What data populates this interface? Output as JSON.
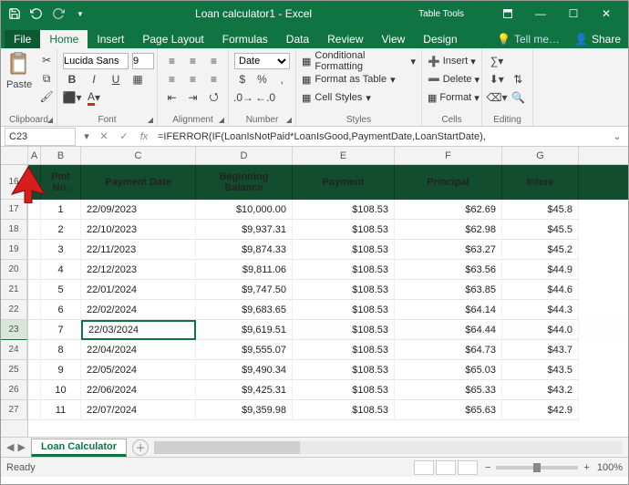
{
  "titlebar": {
    "title": "Loan calculator1 - Excel",
    "tool_context": "Table Tools"
  },
  "tabs": {
    "file": "File",
    "home": "Home",
    "insert": "Insert",
    "page_layout": "Page Layout",
    "formulas": "Formulas",
    "data": "Data",
    "review": "Review",
    "view": "View",
    "design": "Design",
    "tell_me": "Tell me…",
    "share": "Share"
  },
  "ribbon": {
    "paste": "Paste",
    "font_name": "Lucida Sans",
    "font_size": "9",
    "number_format": "Date",
    "cond_fmt": "Conditional Formatting",
    "fmt_table": "Format as Table",
    "cell_styles": "Cell Styles",
    "insert": "Insert",
    "delete": "Delete",
    "format": "Format",
    "groups": {
      "clipboard": "Clipboard",
      "font": "Font",
      "alignment": "Alignment",
      "number": "Number",
      "styles": "Styles",
      "cells": "Cells",
      "editing": "Editing"
    }
  },
  "formula_bar": {
    "name": "C23",
    "formula": "=IFERROR(IF(LoanIsNotPaid*LoanIsGood,PaymentDate,LoanStartDate),"
  },
  "columns": [
    "A",
    "B",
    "C",
    "D",
    "E",
    "F",
    "G"
  ],
  "row_numbers": [
    "16",
    "17",
    "18",
    "19",
    "20",
    "21",
    "22",
    "23",
    "24",
    "25",
    "26",
    "27"
  ],
  "active_row": "23",
  "headers": {
    "pmt_no": "Pmt No.",
    "payment_date": "Payment Date",
    "beg_balance": "Beginning Balance",
    "payment": "Payment",
    "principal": "Principal",
    "interest": "Intere"
  },
  "rows": [
    {
      "no": "1",
      "date": "22/09/2023",
      "bal": "$10,000.00",
      "pay": "$108.53",
      "prin": "$62.69",
      "int": "$45.8"
    },
    {
      "no": "2",
      "date": "22/10/2023",
      "bal": "$9,937.31",
      "pay": "$108.53",
      "prin": "$62.98",
      "int": "$45.5"
    },
    {
      "no": "3",
      "date": "22/11/2023",
      "bal": "$9,874.33",
      "pay": "$108.53",
      "prin": "$63.27",
      "int": "$45.2"
    },
    {
      "no": "4",
      "date": "22/12/2023",
      "bal": "$9,811.06",
      "pay": "$108.53",
      "prin": "$63.56",
      "int": "$44.9"
    },
    {
      "no": "5",
      "date": "22/01/2024",
      "bal": "$9,747.50",
      "pay": "$108.53",
      "prin": "$63.85",
      "int": "$44.6"
    },
    {
      "no": "6",
      "date": "22/02/2024",
      "bal": "$9,683.65",
      "pay": "$108.53",
      "prin": "$64.14",
      "int": "$44.3"
    },
    {
      "no": "7",
      "date": "22/03/2024",
      "bal": "$9,619.51",
      "pay": "$108.53",
      "prin": "$64.44",
      "int": "$44.0"
    },
    {
      "no": "8",
      "date": "22/04/2024",
      "bal": "$9,555.07",
      "pay": "$108.53",
      "prin": "$64.73",
      "int": "$43.7"
    },
    {
      "no": "9",
      "date": "22/05/2024",
      "bal": "$9,490.34",
      "pay": "$108.53",
      "prin": "$65.03",
      "int": "$43.5"
    },
    {
      "no": "10",
      "date": "22/06/2024",
      "bal": "$9,425.31",
      "pay": "$108.53",
      "prin": "$65.33",
      "int": "$43.2"
    },
    {
      "no": "11",
      "date": "22/07/2024",
      "bal": "$9,359.98",
      "pay": "$108.53",
      "prin": "$65.63",
      "int": "$42.9"
    }
  ],
  "sheet_tab": "Loan Calculator",
  "status": {
    "ready": "Ready",
    "zoom": "100%"
  }
}
